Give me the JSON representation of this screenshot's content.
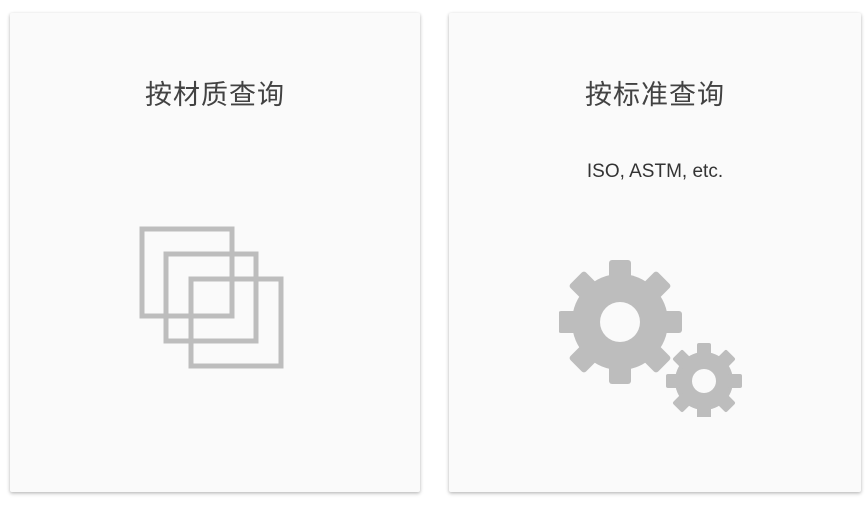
{
  "cards": [
    {
      "title": "按材质查询",
      "icon": "layered-squares-icon"
    },
    {
      "title": "按标准查询",
      "subtitle": "ISO, ASTM, etc.",
      "icon": "gears-icon"
    }
  ],
  "colors": {
    "card_background": "#fafafa",
    "title_text": "#424242",
    "icon_gray": "#bdbdbd"
  }
}
